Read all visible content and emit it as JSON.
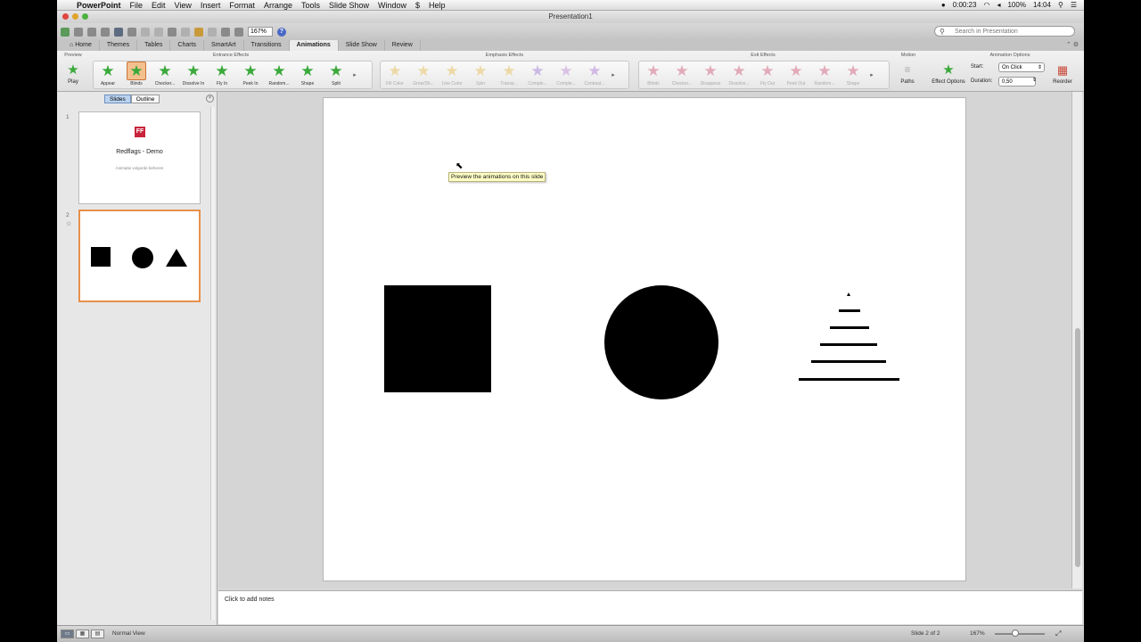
{
  "menubar": {
    "app_name": "PowerPoint",
    "items": [
      "File",
      "Edit",
      "View",
      "Insert",
      "Format",
      "Arrange",
      "Tools",
      "Slide Show",
      "Window",
      "Help"
    ],
    "timer": "0:00:23",
    "battery": "100%",
    "clock": "14:04"
  },
  "window": {
    "title": "Presentation1"
  },
  "toolbar": {
    "zoom": "167%",
    "search_placeholder": "Search in Presentation"
  },
  "ribbon_tabs": [
    "Home",
    "Themes",
    "Tables",
    "Charts",
    "SmartArt",
    "Transitions",
    "Animations",
    "Slide Show",
    "Review"
  ],
  "active_tab": "Animations",
  "ribbon": {
    "preview_group": "Preview",
    "play_label": "Play",
    "entrance_group": "Entrance Effects",
    "entrance": [
      "Appear",
      "Blinds",
      "Checker...",
      "Dissolve In",
      "Fly In",
      "Peek In",
      "Random...",
      "Shape",
      "Split"
    ],
    "emphasis_group": "Emphasis Effects",
    "emphasis": [
      "Fill Color",
      "Grow/Sh...",
      "Line Color",
      "Spin",
      "Transp...",
      "Comple...",
      "Comple...",
      "Contrast..."
    ],
    "exit_group": "Exit Effects",
    "exit": [
      "Blinds",
      "Checker...",
      "Disappear",
      "Dissolve...",
      "Fly Out",
      "Peek Out",
      "Random...",
      "Shape"
    ],
    "motion_group": "Motion",
    "paths_label": "Paths",
    "effect_options_label": "Effect Options",
    "options_group": "Animation Options",
    "start_label": "Start:",
    "start_value": "On Click",
    "duration_label": "Duration:",
    "duration_value": "0,50",
    "reorder_label": "Reorder"
  },
  "leftpane": {
    "tab_slides": "Slides",
    "tab_outline": "Outline",
    "slides": [
      {
        "number": "1",
        "title": "Redflags - Demo",
        "subtitle": "Animatie volgorde beheren"
      },
      {
        "number": "2"
      }
    ]
  },
  "tooltip": "Preview the animations on this slide",
  "notes_placeholder": "Click to add notes",
  "status": {
    "view": "Normal View",
    "slide_indicator": "Slide 2 of 2",
    "zoom": "167%"
  },
  "colors": {
    "entrance_star": "#3aa93a",
    "emphasis_star": "#e8c468",
    "exit_star": "#d87a94",
    "selected_outline": "#e6904a"
  }
}
